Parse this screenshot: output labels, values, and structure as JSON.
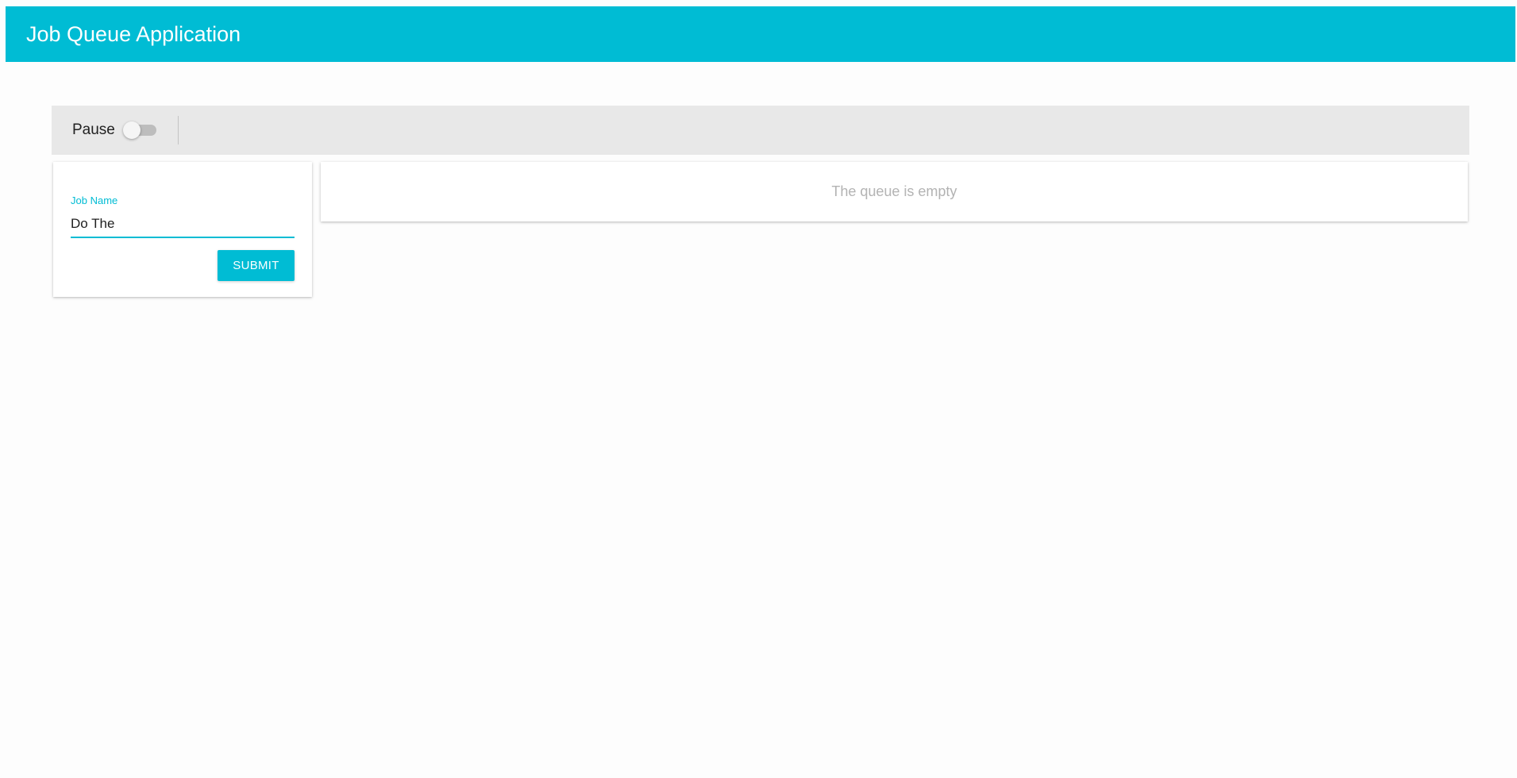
{
  "header": {
    "title": "Job Queue Application",
    "color": "#00bcd4"
  },
  "toolbar": {
    "pause_label": "Pause",
    "pause_toggle_on": false
  },
  "job_form": {
    "field_label": "Job Name",
    "field_value": "Do The ",
    "submit_label": "SUBMIT"
  },
  "queue": {
    "empty_message": "The queue is empty"
  }
}
